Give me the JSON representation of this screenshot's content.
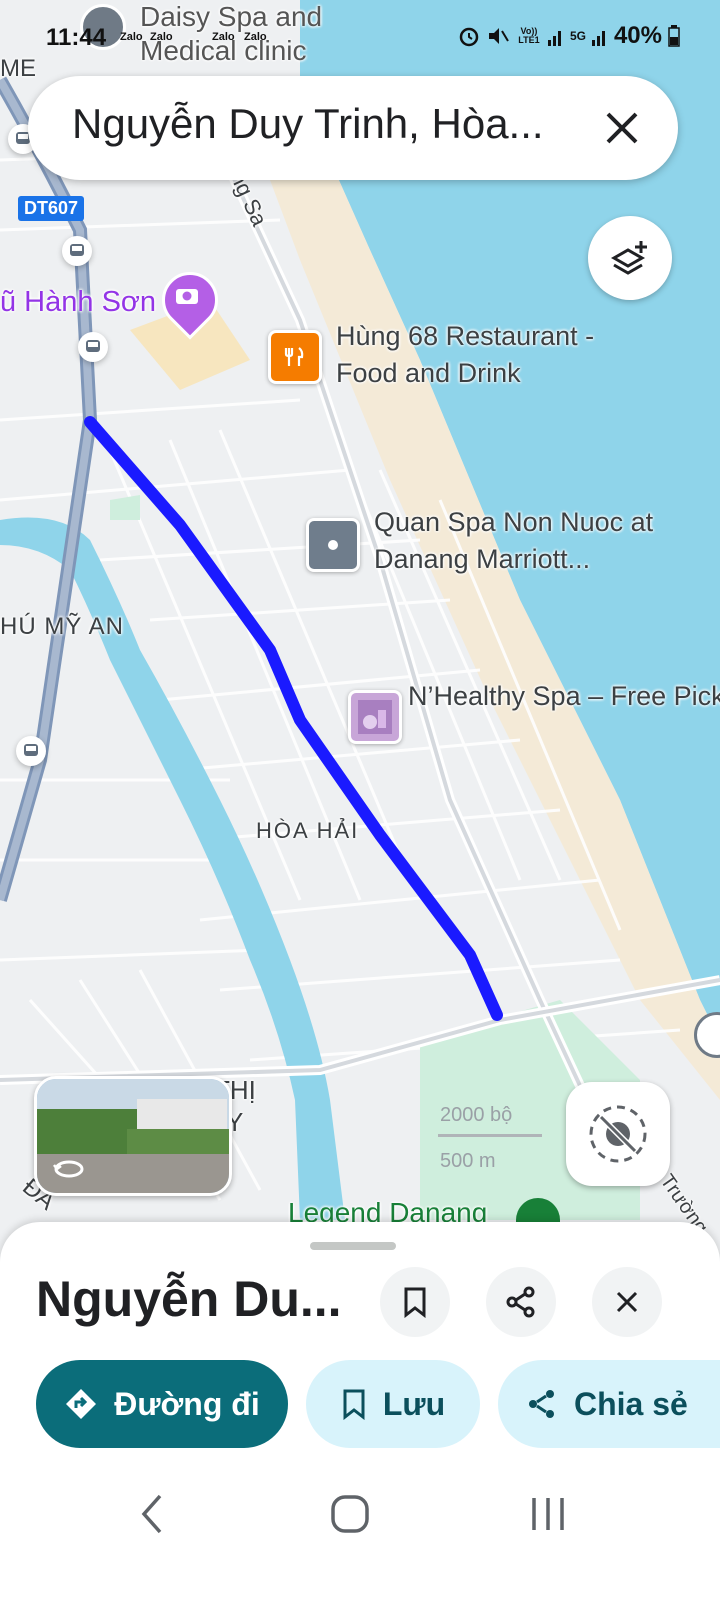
{
  "status_bar": {
    "time": "11:44",
    "notif_icons": [
      "Zalo",
      "Zalo",
      "Zalo",
      "Zalo"
    ],
    "volte": "Vo)) LTE1",
    "network": "5G",
    "battery": "40%"
  },
  "search": {
    "query": "Nguyễn Duy Trinh, Hòa..."
  },
  "map": {
    "labels": {
      "daisy": "Daisy Spa and Medical clinic",
      "me": "ME",
      "dt607": "DT607",
      "hanh_son": "ũ Hành Sơn",
      "hung68": "Hùng 68 Restaurant - Food and Drink",
      "quan_spa": "Quan Spa Non Nuoc at Danang Marriott...",
      "nhealthy": "N’Healthy Spa – Free Pickup,엔헬시 스파 – 무",
      "phu_my_an": "HÚ MỸ AN",
      "hoa_hai": "HÒA HẢI",
      "road_sa": "ng Sa",
      "thi": "THỊ",
      "y": "Y",
      "da": "ĐÀ",
      "legend_danang": "Legend Danang",
      "truong": "Trường",
      "scale_ft": "2000 bộ",
      "scale_m": "500 m"
    },
    "route_color": "#1a1aff"
  },
  "place_panel": {
    "title": "Nguyễn Du...",
    "directions_label": "Đường đi",
    "save_label": "Lưu",
    "share_label": "Chia sẻ"
  },
  "colors": {
    "accent": "#0b6d7a",
    "chip_bg": "#d8f3fb"
  }
}
